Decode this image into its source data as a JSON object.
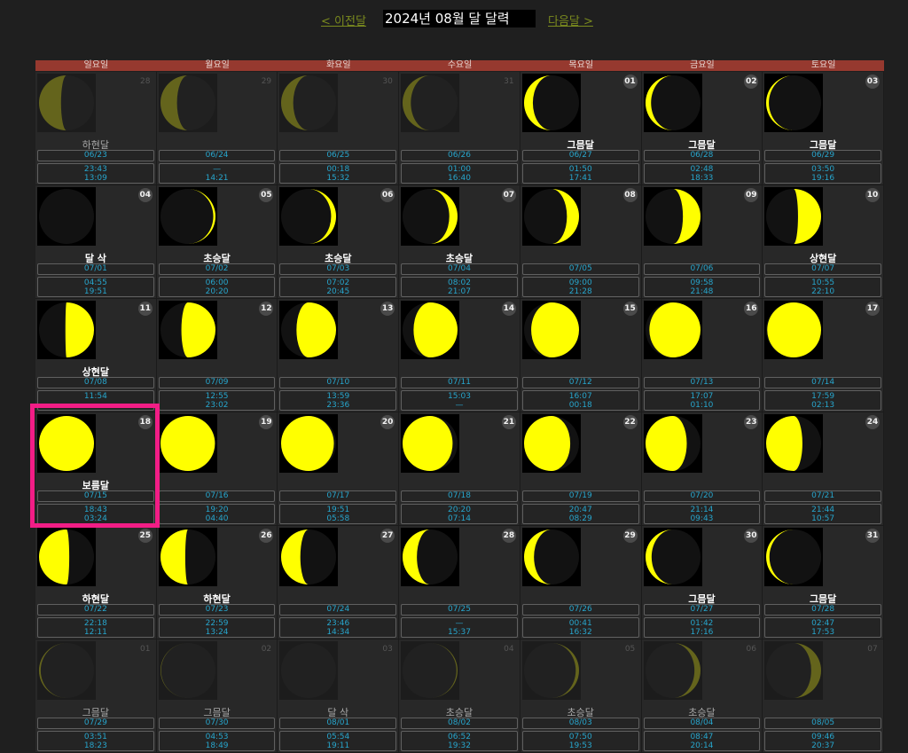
{
  "nav": {
    "prev_label": "< 이전달",
    "title": "2024년 08월 달 달력",
    "next_label": "다음달 >"
  },
  "weekdays": [
    "일요일",
    "월요일",
    "화요일",
    "수요일",
    "목요일",
    "금요일",
    "토요일"
  ],
  "colors": {
    "moon": "#ffff00",
    "header": "#96392f",
    "time_text": "#27a5cc",
    "highlight": "#f21d86"
  },
  "icon": "moon-phase-icon",
  "days": [
    {
      "day": "28",
      "phase": "하현달",
      "lunar": "06/23",
      "rise": "23:43",
      "set": "13:09",
      "lit": 0.4,
      "right": false,
      "faded": true
    },
    {
      "day": "29",
      "phase": "",
      "lunar": "06/24",
      "rise": "—",
      "set": "14:21",
      "lit": 0.3,
      "right": false,
      "faded": true
    },
    {
      "day": "30",
      "phase": "",
      "lunar": "06/25",
      "rise": "00:18",
      "set": "15:32",
      "lit": 0.22,
      "right": false,
      "faded": true
    },
    {
      "day": "31",
      "phase": "",
      "lunar": "06/26",
      "rise": "01:00",
      "set": "16:40",
      "lit": 0.15,
      "right": false,
      "faded": true
    },
    {
      "day": "01",
      "phase": "그믐달",
      "lunar": "06/27",
      "rise": "01:50",
      "set": "17:41",
      "lit": 0.16,
      "right": false,
      "faded": false
    },
    {
      "day": "02",
      "phase": "그믐달",
      "lunar": "06/28",
      "rise": "02:48",
      "set": "18:33",
      "lit": 0.1,
      "right": false,
      "faded": false
    },
    {
      "day": "03",
      "phase": "그믐달",
      "lunar": "06/29",
      "rise": "03:50",
      "set": "19:16",
      "lit": 0.05,
      "right": false,
      "faded": false
    },
    {
      "day": "04",
      "phase": "달 삭",
      "lunar": "07/01",
      "rise": "04:55",
      "set": "19:51",
      "lit": 0.0,
      "right": true,
      "faded": false
    },
    {
      "day": "05",
      "phase": "초승달",
      "lunar": "07/02",
      "rise": "06:00",
      "set": "20:20",
      "lit": 0.04,
      "right": true,
      "faded": false
    },
    {
      "day": "06",
      "phase": "초승달",
      "lunar": "07/03",
      "rise": "07:02",
      "set": "20:45",
      "lit": 0.09,
      "right": true,
      "faded": false
    },
    {
      "day": "07",
      "phase": "초승달",
      "lunar": "07/04",
      "rise": "08:02",
      "set": "21:07",
      "lit": 0.15,
      "right": true,
      "faded": false
    },
    {
      "day": "08",
      "phase": "",
      "lunar": "07/05",
      "rise": "09:00",
      "set": "21:28",
      "lit": 0.22,
      "right": true,
      "faded": false
    },
    {
      "day": "09",
      "phase": "",
      "lunar": "07/06",
      "rise": "09:58",
      "set": "21:48",
      "lit": 0.32,
      "right": true,
      "faded": false
    },
    {
      "day": "10",
      "phase": "상현달",
      "lunar": "07/07",
      "rise": "10:55",
      "set": "22:10",
      "lit": 0.42,
      "right": true,
      "faded": false
    },
    {
      "day": "11",
      "phase": "상현달",
      "lunar": "07/08",
      "rise": "11:54",
      "set": "",
      "lit": 0.52,
      "right": true,
      "faded": false
    },
    {
      "day": "12",
      "phase": "",
      "lunar": "07/09",
      "rise": "12:55",
      "set": "23:02",
      "lit": 0.62,
      "right": true,
      "faded": false
    },
    {
      "day": "13",
      "phase": "",
      "lunar": "07/10",
      "rise": "13:59",
      "set": "23:36",
      "lit": 0.72,
      "right": true,
      "faded": false
    },
    {
      "day": "14",
      "phase": "",
      "lunar": "07/11",
      "rise": "15:03",
      "set": "—",
      "lit": 0.8,
      "right": true,
      "faded": false
    },
    {
      "day": "15",
      "phase": "",
      "lunar": "07/12",
      "rise": "16:07",
      "set": "00:18",
      "lit": 0.87,
      "right": true,
      "faded": false
    },
    {
      "day": "16",
      "phase": "",
      "lunar": "07/13",
      "rise": "17:07",
      "set": "01:10",
      "lit": 0.93,
      "right": true,
      "faded": false
    },
    {
      "day": "17",
      "phase": "",
      "lunar": "07/14",
      "rise": "17:59",
      "set": "02:13",
      "lit": 0.98,
      "right": true,
      "faded": false
    },
    {
      "day": "18",
      "phase": "보름달",
      "lunar": "07/15",
      "rise": "18:43",
      "set": "03:24",
      "lit": 1.0,
      "right": true,
      "faded": false
    },
    {
      "day": "19",
      "phase": "",
      "lunar": "07/16",
      "rise": "19:20",
      "set": "04:40",
      "lit": 0.99,
      "right": false,
      "faded": false
    },
    {
      "day": "20",
      "phase": "",
      "lunar": "07/17",
      "rise": "19:51",
      "set": "05:58",
      "lit": 0.96,
      "right": false,
      "faded": false
    },
    {
      "day": "21",
      "phase": "",
      "lunar": "07/18",
      "rise": "20:20",
      "set": "07:14",
      "lit": 0.91,
      "right": false,
      "faded": false
    },
    {
      "day": "22",
      "phase": "",
      "lunar": "07/19",
      "rise": "20:47",
      "set": "08:29",
      "lit": 0.84,
      "right": false,
      "faded": false
    },
    {
      "day": "23",
      "phase": "",
      "lunar": "07/20",
      "rise": "21:14",
      "set": "09:43",
      "lit": 0.75,
      "right": false,
      "faded": false
    },
    {
      "day": "24",
      "phase": "",
      "lunar": "07/21",
      "rise": "21:44",
      "set": "10:57",
      "lit": 0.66,
      "right": false,
      "faded": false
    },
    {
      "day": "25",
      "phase": "하현달",
      "lunar": "07/22",
      "rise": "22:18",
      "set": "12:11",
      "lit": 0.55,
      "right": false,
      "faded": false
    },
    {
      "day": "26",
      "phase": "하현달",
      "lunar": "07/23",
      "rise": "22:59",
      "set": "13:24",
      "lit": 0.45,
      "right": false,
      "faded": false
    },
    {
      "day": "27",
      "phase": "",
      "lunar": "07/24",
      "rise": "23:46",
      "set": "14:34",
      "lit": 0.35,
      "right": false,
      "faded": false
    },
    {
      "day": "28",
      "phase": "",
      "lunar": "07/25",
      "rise": "—",
      "set": "15:37",
      "lit": 0.26,
      "right": false,
      "faded": false
    },
    {
      "day": "29",
      "phase": "",
      "lunar": "07/26",
      "rise": "00:41",
      "set": "16:32",
      "lit": 0.18,
      "right": false,
      "faded": false
    },
    {
      "day": "30",
      "phase": "그믐달",
      "lunar": "07/27",
      "rise": "01:42",
      "set": "17:16",
      "lit": 0.11,
      "right": false,
      "faded": false
    },
    {
      "day": "31",
      "phase": "그믐달",
      "lunar": "07/28",
      "rise": "02:47",
      "set": "17:53",
      "lit": 0.06,
      "right": false,
      "faded": false
    },
    {
      "day": "01",
      "phase": "그믐달",
      "lunar": "07/29",
      "rise": "03:51",
      "set": "18:23",
      "lit": 0.03,
      "right": false,
      "faded": true
    },
    {
      "day": "02",
      "phase": "그믐달",
      "lunar": "07/30",
      "rise": "04:53",
      "set": "18:49",
      "lit": 0.01,
      "right": false,
      "faded": true
    },
    {
      "day": "03",
      "phase": "달 삭",
      "lunar": "08/01",
      "rise": "05:54",
      "set": "19:11",
      "lit": 0.0,
      "right": true,
      "faded": true
    },
    {
      "day": "04",
      "phase": "초승달",
      "lunar": "08/02",
      "rise": "06:52",
      "set": "19:32",
      "lit": 0.02,
      "right": true,
      "faded": true
    },
    {
      "day": "05",
      "phase": "초승달",
      "lunar": "08/03",
      "rise": "07:50",
      "set": "19:53",
      "lit": 0.06,
      "right": true,
      "faded": true
    },
    {
      "day": "06",
      "phase": "초승달",
      "lunar": "08/04",
      "rise": "08:47",
      "set": "20:14",
      "lit": 0.11,
      "right": true,
      "faded": true
    },
    {
      "day": "07",
      "phase": "",
      "lunar": "08/05",
      "rise": "09:46",
      "set": "20:37",
      "lit": 0.18,
      "right": true,
      "faded": true
    }
  ]
}
